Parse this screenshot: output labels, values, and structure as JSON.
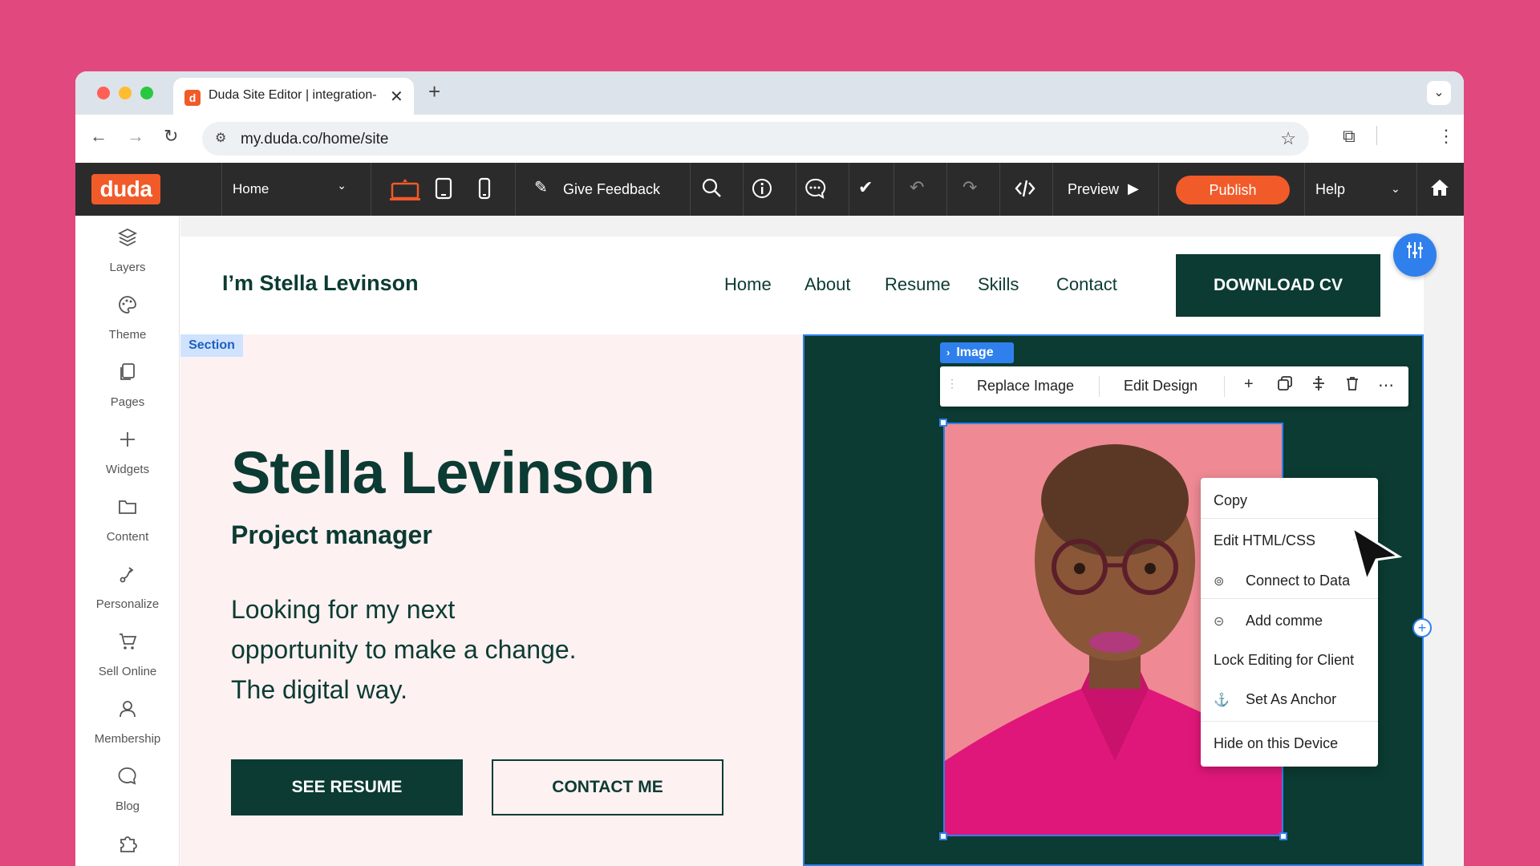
{
  "browser": {
    "tab_title": "Duda Site Editor | integration-",
    "tab_favicon": "d",
    "url": "my.duda.co/home/site"
  },
  "editor": {
    "logo": "duda",
    "page_selector": "Home",
    "give_feedback": "Give Feedback",
    "preview": "Preview",
    "publish": "Publish",
    "help": "Help"
  },
  "sidebar": {
    "items": [
      {
        "label": "Layers",
        "icon": "layers-icon"
      },
      {
        "label": "Theme",
        "icon": "palette-icon"
      },
      {
        "label": "Pages",
        "icon": "pages-icon"
      },
      {
        "label": "Widgets",
        "icon": "plus-icon"
      },
      {
        "label": "Content",
        "icon": "folder-icon"
      },
      {
        "label": "Personalize",
        "icon": "personalize-icon"
      },
      {
        "label": "Sell Online",
        "icon": "cart-icon"
      },
      {
        "label": "Membership",
        "icon": "user-icon"
      },
      {
        "label": "Blog",
        "icon": "chat-icon"
      }
    ]
  },
  "site": {
    "logo_text": "I’m Stella Levinson",
    "nav": [
      "Home",
      "About",
      "Resume",
      "Skills",
      "Contact"
    ],
    "download_cv": "DOWNLOAD CV",
    "section_tag": "Section",
    "hero": {
      "name": "Stella Levinson",
      "role": "Project manager",
      "description_lines": [
        "Looking for my next",
        "opportunity to make a change.",
        "The digital way."
      ],
      "btn_resume": "SEE RESUME",
      "btn_contact": "CONTACT ME"
    }
  },
  "image_widget": {
    "tag": "Image",
    "replace_image": "Replace Image",
    "edit_design": "Edit Design"
  },
  "context_menu": {
    "items": [
      {
        "label": "Copy",
        "icon": ""
      },
      {
        "label": "Edit HTML/CSS",
        "icon": "code-icon"
      },
      {
        "label": "Connect to Data",
        "icon": "data-link-icon"
      },
      {
        "label": "Add comme",
        "icon": "comment-icon"
      },
      {
        "label": "Lock Editing for Client",
        "icon": ""
      },
      {
        "label": "Set As Anchor",
        "icon": "anchor-icon"
      },
      {
        "label": "Hide on this Device",
        "icon": ""
      }
    ]
  },
  "colors": {
    "page_bg": "#e0487e",
    "brand_orange": "#f15a29",
    "site_dark_green": "#0b3b32",
    "hero_pink": "#fdf1f2",
    "selection_blue": "#2f80ed",
    "photo_pink": "#ef8a94",
    "shirt_magenta": "#e0177a"
  }
}
